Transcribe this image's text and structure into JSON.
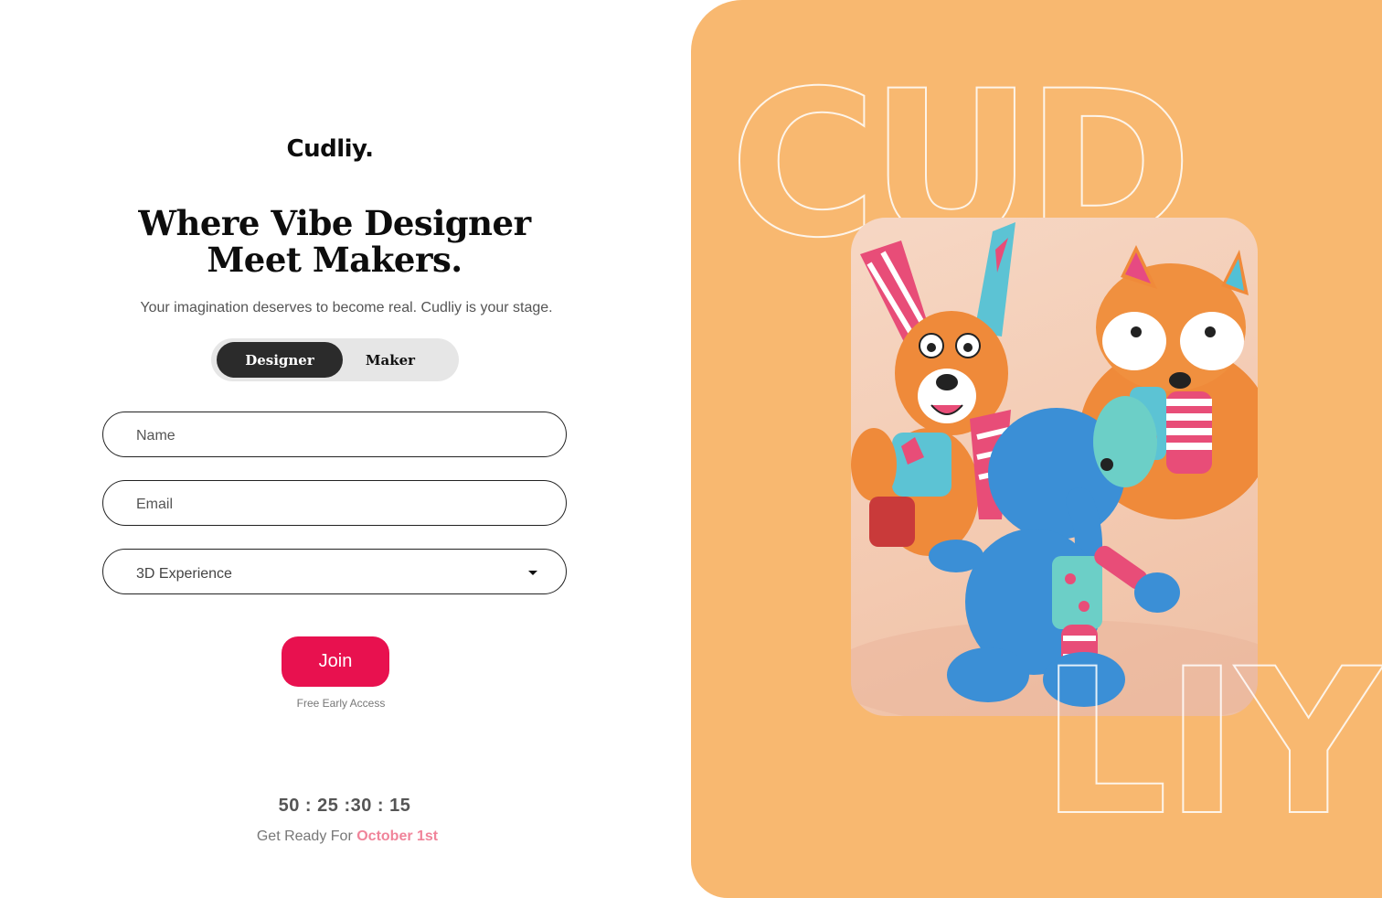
{
  "brand": {
    "logo": "Cudliy."
  },
  "hero": {
    "headline_line1": "Where Vibe Designer",
    "headline_line2": "Meet Makers.",
    "subtitle": "Your imagination deserves to become real. Cudliy is your stage."
  },
  "role_toggle": {
    "options": [
      "Designer",
      "Maker"
    ],
    "selected": "Designer"
  },
  "form": {
    "name_placeholder": "Name",
    "email_placeholder": "Email",
    "experience_value": "3D Experience",
    "join_label": "Join",
    "join_note": "Free Early Access"
  },
  "countdown": {
    "display": "50 : 25 :30 : 15",
    "ready_prefix": "Get Ready For ",
    "ready_date": "October 1st"
  },
  "visual": {
    "watermark_top": "CUD",
    "watermark_bottom": "LIY",
    "panel_color": "#f8b870",
    "accent_color": "#e8114f"
  }
}
